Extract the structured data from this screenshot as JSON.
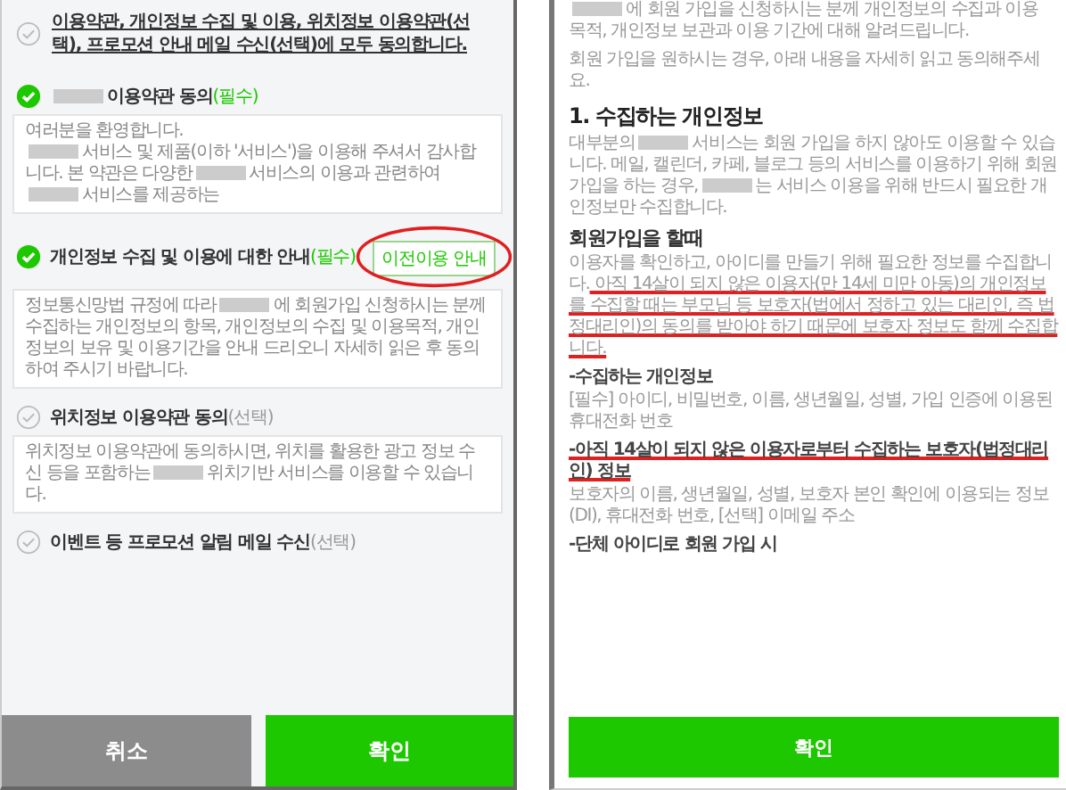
{
  "agreement": {
    "all_agree": {
      "checked": false,
      "text": "이용약관, 개인정보 수집 및 이용, 위치정보 이용약관(선택), 프로모션 안내 메일 수신(선택)에 모두 동의합니다."
    },
    "items": [
      {
        "checked": true,
        "title": [
          {
            "kind": "redacted"
          },
          {
            "kind": "text",
            "text": "이용약관 동의"
          }
        ],
        "tag": "(필수)",
        "required": true,
        "paragraphs": [
          [
            {
              "kind": "text",
              "text": "여러분을 환영합니다."
            }
          ],
          [
            {
              "kind": "redacted"
            },
            {
              "kind": "text",
              "text": "서비스 및 제품(이하 '서비스')을 이용해 주셔서 감사합니다. 본 약관은 다양한"
            },
            {
              "kind": "redacted"
            },
            {
              "kind": "text",
              "text": "서비스의 이용과 관련하여"
            },
            {
              "kind": "redacted"
            },
            {
              "kind": "text",
              "text": "서비스를 제공하는"
            }
          ]
        ]
      },
      {
        "checked": true,
        "title": [
          {
            "kind": "text",
            "text": "개인정보 수집 및 이용에 대한 안내"
          }
        ],
        "tag": "(필수)",
        "required": true,
        "button": {
          "label": "이전이용 안내",
          "annotated": true
        },
        "paragraphs": [
          [
            {
              "kind": "text",
              "text": "정보통신망법 규정에 따라"
            },
            {
              "kind": "redacted"
            },
            {
              "kind": "text",
              "text": "에 회원가입 신청하시는 분께 수집하는 개인정보의 항목, 개인정보의 수집 및 이용목적, 개인정보의 보유 및 이용기간을 안내 드리오니 자세히 읽은 후 동의하여 주시기 바랍니다."
            }
          ]
        ]
      },
      {
        "checked": false,
        "title": [
          {
            "kind": "text",
            "text": "위치정보 이용약관 동의"
          }
        ],
        "tag": "(선택)",
        "required": false,
        "paragraphs": [
          [
            {
              "kind": "text",
              "text": "위치정보 이용약관에 동의하시면, 위치를 활용한 광고 정보 수신 등을 포함하는"
            },
            {
              "kind": "redacted"
            },
            {
              "kind": "text",
              "text": "위치기반 서비스를 이용할 수 있습니다."
            }
          ]
        ]
      },
      {
        "checked": false,
        "title": [
          {
            "kind": "text",
            "text": "이벤트 등 프로모션 알림 메일 수신"
          }
        ],
        "tag": "(선택)",
        "required": false
      }
    ],
    "buttons": [
      {
        "label": "취소",
        "kind": "cancel"
      },
      {
        "label": "확인",
        "kind": "confirm"
      }
    ]
  },
  "policy": {
    "blocks": [
      {
        "kind": "para",
        "parts": [
          {
            "kind": "redacted"
          },
          {
            "kind": "text",
            "text": "에 회원 가입을 신청하시는 분께 개인정보의 수집과 이용 목적, 개인정보 보관과 이용 기간에 대해 알려드립니다."
          }
        ]
      },
      {
        "kind": "para",
        "parts": [
          {
            "kind": "text",
            "text": "회원 가입을 원하시는 경우, 아래 내용을 자세히 읽고 동의해주세요."
          }
        ]
      },
      {
        "kind": "heading",
        "parts": [
          {
            "kind": "text",
            "text": "1. 수집하는 개인정보"
          }
        ]
      },
      {
        "kind": "para",
        "parts": [
          {
            "kind": "text",
            "text": "대부분의"
          },
          {
            "kind": "redacted"
          },
          {
            "kind": "text",
            "text": "서비스는 회원 가입을 하지 않아도 이용할 수 있습니다. 메일, 캘린더, 카페, 블로그 등의 서비스를 이용하기 위해 회원 가입을 하는 경우,"
          },
          {
            "kind": "redacted"
          },
          {
            "kind": "text",
            "text": "는 서비스 이용을 위해 반드시 필요한 개인정보만 수집합니다."
          }
        ]
      },
      {
        "kind": "subheading",
        "parts": [
          {
            "kind": "text",
            "text": "회원가입을 할때"
          }
        ]
      },
      {
        "kind": "para",
        "parts": [
          {
            "kind": "text",
            "text": "이용자를 확인하고, 아이디를 만들기 위해 필요한 정보를 수집합니다."
          },
          {
            "kind": "text",
            "text": " 아직 14살이 되지 않은 이용자(만 14세 미만 아동)의 개인정보를 수집할 때는 부모님 등 보호자(법에서 정하고 있는 대리인, 즉 법정대리인)의 동의를 받아야 하기 때문에 보호자 정보도 함께 수집합니다.",
            "underlined": true
          }
        ]
      },
      {
        "kind": "bold",
        "parts": [
          {
            "kind": "text",
            "text": "-수집하는 개인정보"
          }
        ]
      },
      {
        "kind": "para",
        "parts": [
          {
            "kind": "text",
            "text": "[필수] 아이디, 비밀번호, 이름, 생년월일, 성별, 가입 인증에 이용된 휴대전화 번호"
          }
        ]
      },
      {
        "kind": "bold",
        "parts": [
          {
            "kind": "text",
            "text": "-아직 14살이 되지 않은 이용자로부터 수집하는 보호자(법정대리인) 정보",
            "underlined": true
          }
        ]
      },
      {
        "kind": "para",
        "parts": [
          {
            "kind": "text",
            "text": "보호자의 이름, 생년월일, 성별, 보호자 본인 확인에 이용되는 정보(DI), 휴대전화 번호, [선택] 이메일 주소"
          }
        ]
      },
      {
        "kind": "bold",
        "parts": [
          {
            "kind": "text",
            "text": "-단체 아이디로 회원 가입 시"
          }
        ]
      }
    ],
    "button": {
      "label": "확인"
    }
  }
}
